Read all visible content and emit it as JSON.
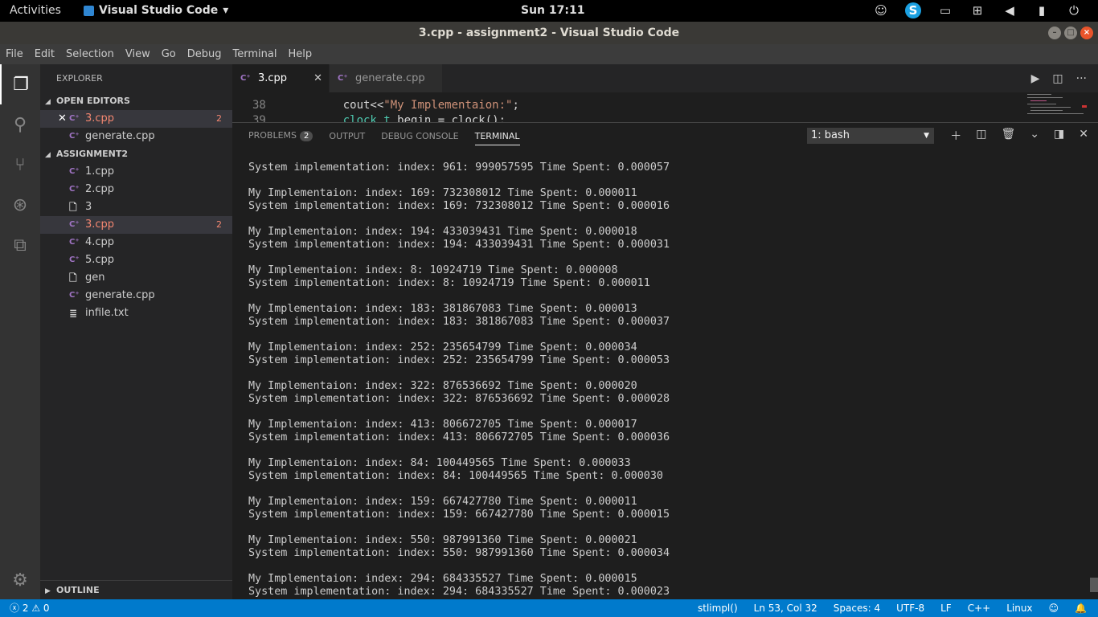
{
  "system": {
    "activities": "Activities",
    "app_name": "Visual Studio Code",
    "clock": "Sun 17:11"
  },
  "window": {
    "title": "3.cpp - assignment2 - Visual Studio Code"
  },
  "menu": [
    "File",
    "Edit",
    "Selection",
    "View",
    "Go",
    "Debug",
    "Terminal",
    "Help"
  ],
  "explorer": {
    "title": "EXPLORER",
    "open_editors_label": "OPEN EDITORS",
    "open_editors": [
      {
        "name": "3.cpp",
        "badge": "2"
      },
      {
        "name": "generate.cpp",
        "badge": ""
      }
    ],
    "folder_label": "ASSIGNMENT2",
    "files": [
      {
        "name": "1.cpp",
        "type": "cpp",
        "badge": ""
      },
      {
        "name": "2.cpp",
        "type": "cpp",
        "badge": ""
      },
      {
        "name": "3",
        "type": "file",
        "badge": ""
      },
      {
        "name": "3.cpp",
        "type": "cpp",
        "badge": "2"
      },
      {
        "name": "4.cpp",
        "type": "cpp",
        "badge": ""
      },
      {
        "name": "5.cpp",
        "type": "cpp",
        "badge": ""
      },
      {
        "name": "gen",
        "type": "file",
        "badge": ""
      },
      {
        "name": "generate.cpp",
        "type": "cpp",
        "badge": ""
      },
      {
        "name": "infile.txt",
        "type": "file",
        "badge": ""
      }
    ],
    "outline_label": "OUTLINE"
  },
  "tabs": [
    {
      "label": "3.cpp",
      "active": true
    },
    {
      "label": "generate.cpp",
      "active": false
    }
  ],
  "editor": {
    "lines": [
      {
        "num": "38",
        "indent": "    ",
        "pre": "cout<<",
        "str": "\"My Implementaion:\"",
        "post": ";"
      },
      {
        "num": "39",
        "indent": "    ",
        "pre": "",
        "kw": "clock_t",
        "post": " begin = clock();"
      }
    ]
  },
  "panel": {
    "tabs": [
      "PROBLEMS",
      "OUTPUT",
      "DEBUG CONSOLE",
      "TERMINAL"
    ],
    "problems_count": "2",
    "terminal_select": "1: bash",
    "terminal_lines": [
      "System implementation: index: 961: 999057595 Time Spent: 0.000057",
      "",
      "My Implementaion: index: 169: 732308012 Time Spent: 0.000011",
      "System implementation: index: 169: 732308012 Time Spent: 0.000016",
      "",
      "My Implementaion: index: 194: 433039431 Time Spent: 0.000018",
      "System implementation: index: 194: 433039431 Time Spent: 0.000031",
      "",
      "My Implementaion: index: 8: 10924719 Time Spent: 0.000008",
      "System implementation: index: 8: 10924719 Time Spent: 0.000011",
      "",
      "My Implementaion: index: 183: 381867083 Time Spent: 0.000013",
      "System implementation: index: 183: 381867083 Time Spent: 0.000037",
      "",
      "My Implementaion: index: 252: 235654799 Time Spent: 0.000034",
      "System implementation: index: 252: 235654799 Time Spent: 0.000053",
      "",
      "My Implementaion: index: 322: 876536692 Time Spent: 0.000020",
      "System implementation: index: 322: 876536692 Time Spent: 0.000028",
      "",
      "My Implementaion: index: 413: 806672705 Time Spent: 0.000017",
      "System implementation: index: 413: 806672705 Time Spent: 0.000036",
      "",
      "My Implementaion: index: 84: 100449565 Time Spent: 0.000033",
      "System implementation: index: 84: 100449565 Time Spent: 0.000030",
      "",
      "My Implementaion: index: 159: 667427780 Time Spent: 0.000011",
      "System implementation: index: 159: 667427780 Time Spent: 0.000015",
      "",
      "My Implementaion: index: 550: 987991360 Time Spent: 0.000021",
      "System implementation: index: 550: 987991360 Time Spent: 0.000034",
      "",
      "My Implementaion: index: 294: 684335527 Time Spent: 0.000015",
      "System implementation: index: 294: 684335527 Time Spent: 0.000023"
    ]
  },
  "status": {
    "errors": "2",
    "warnings": "0",
    "function": "stlimpl()",
    "position": "Ln 53, Col 32",
    "spaces": "Spaces: 4",
    "encoding": "UTF-8",
    "eol": "LF",
    "language": "C++",
    "platform": "Linux"
  },
  "colors": {
    "accent": "#007acc",
    "error": "#f48771",
    "cpp_icon": "#a074c4"
  }
}
